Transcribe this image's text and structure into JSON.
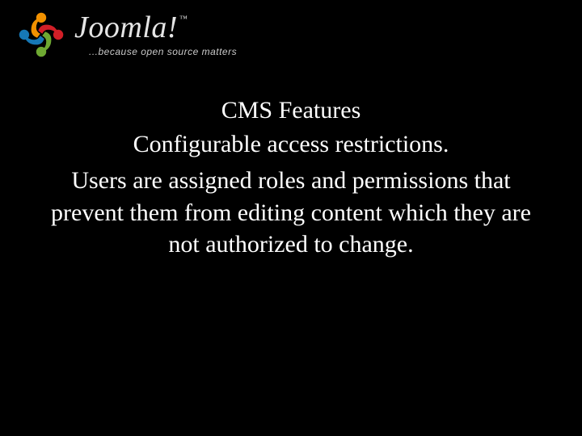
{
  "logo": {
    "name": "Joomla!",
    "trademark": "™",
    "tagline": "...because open source matters"
  },
  "slide": {
    "heading": "CMS Features",
    "subheading": "Configurable access restrictions.",
    "body": "Users are assigned roles and permissions that prevent them from editing content which they are not authorized to change."
  }
}
